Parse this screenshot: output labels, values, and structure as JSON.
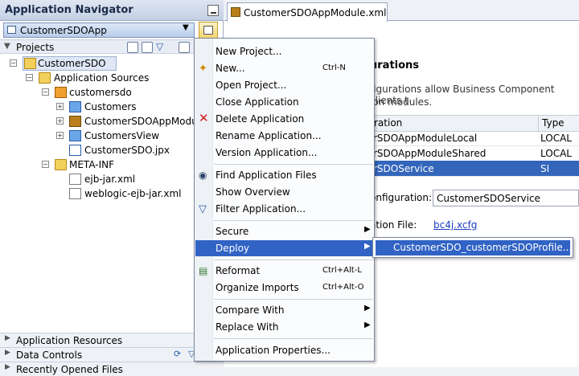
{
  "navigator": {
    "title": "Application Navigator",
    "app_name": "CustomerSDOApp",
    "projects_label": "Projects",
    "tree": [
      {
        "label": "CustomerSDO",
        "icon": "project-icon"
      },
      {
        "label": "Application Sources",
        "icon": "folder-icon"
      },
      {
        "label": "customersdo",
        "icon": "package-icon"
      },
      {
        "label": "Customers",
        "icon": "view-object-icon"
      },
      {
        "label": "CustomerSDOAppModule",
        "icon": "app-module-icon"
      },
      {
        "label": "CustomersView",
        "icon": "view-object-icon"
      },
      {
        "label": "CustomerSDO.jpx",
        "icon": "jpx-file-icon"
      },
      {
        "label": "META-INF",
        "icon": "folder-icon"
      },
      {
        "label": "ejb-jar.xml",
        "icon": "xml-file-icon"
      },
      {
        "label": "weblogic-ejb-jar.xml",
        "icon": "xml-file-icon"
      }
    ],
    "bottom_panels": [
      "Application Resources",
      "Data Controls",
      "Recently Opened Files"
    ]
  },
  "editor": {
    "tab_label": "CustomerSDOAppModule.xml",
    "section_heading": "urations",
    "desc_line1": "figurations allow Business Component clients t",
    "desc_line2": "ion modules.",
    "table": {
      "headers": [
        "ration",
        "Type"
      ],
      "rows": [
        [
          "rSDOAppModuleLocal",
          "LOCAL"
        ],
        [
          "rSDOAppModuleShared",
          "LOCAL"
        ],
        [
          "rSDOService",
          "SI"
        ]
      ]
    },
    "config_label": "onfiguration:",
    "config_value": "CustomerSDOService",
    "file_label": "ation File:",
    "file_link": "bc4j.xcfg"
  },
  "context_menu": {
    "items": [
      {
        "label": "New Project...",
        "shortcut": "",
        "icon": ""
      },
      {
        "label": "New...",
        "shortcut": "Ctrl-N",
        "icon": "new-icon"
      },
      {
        "label": "Open Project...",
        "shortcut": "",
        "icon": ""
      },
      {
        "label": "Close Application",
        "shortcut": "",
        "icon": ""
      },
      {
        "label": "Delete Application",
        "shortcut": "",
        "icon": "delete-icon"
      },
      {
        "label": "Rename Application...",
        "shortcut": "",
        "icon": ""
      },
      {
        "label": "Version Application...",
        "shortcut": "",
        "icon": ""
      },
      {
        "label": "Find Application Files",
        "shortcut": "",
        "icon": "binoculars-icon"
      },
      {
        "label": "Show Overview",
        "shortcut": "",
        "icon": ""
      },
      {
        "label": "Filter Application...",
        "shortcut": "",
        "icon": "filter-icon"
      },
      {
        "label": "Secure",
        "shortcut": "",
        "icon": ""
      },
      {
        "label": "Deploy",
        "shortcut": "",
        "icon": ""
      },
      {
        "label": "Reformat",
        "shortcut": "Ctrl+Alt-L",
        "icon": "reformat-icon"
      },
      {
        "label": "Organize Imports",
        "shortcut": "Ctrl+Alt-O",
        "icon": ""
      },
      {
        "label": "Compare With",
        "shortcut": "",
        "icon": ""
      },
      {
        "label": "Replace With",
        "shortcut": "",
        "icon": ""
      },
      {
        "label": "Application Properties...",
        "shortcut": "",
        "icon": ""
      }
    ],
    "submenu_item": "CustomerSDO_customerSDOProfile..."
  },
  "colors": {
    "highlight": "#3163c5",
    "link": "#1d3ec2"
  }
}
